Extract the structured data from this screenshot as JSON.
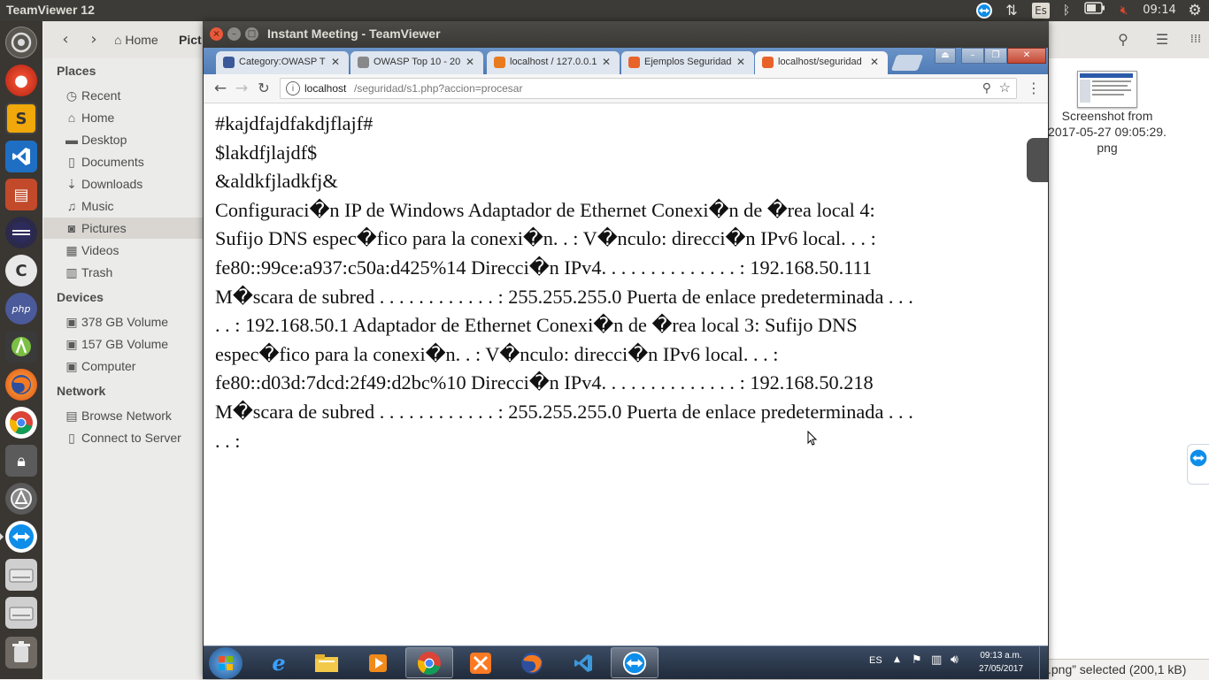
{
  "top_panel": {
    "app_title": "TeamViewer 12",
    "keyboard_layout": "Es",
    "clock": "09:14"
  },
  "nautilus": {
    "nav_home": "Home",
    "nav_current": "Pict",
    "sidebar": {
      "places_header": "Places",
      "places": [
        {
          "label": "Recent",
          "icon": "clock-icon"
        },
        {
          "label": "Home",
          "icon": "home-icon"
        },
        {
          "label": "Desktop",
          "icon": "folder-icon"
        },
        {
          "label": "Documents",
          "icon": "document-icon"
        },
        {
          "label": "Downloads",
          "icon": "download-icon"
        },
        {
          "label": "Music",
          "icon": "music-icon"
        },
        {
          "label": "Pictures",
          "icon": "camera-icon"
        },
        {
          "label": "Videos",
          "icon": "film-icon"
        },
        {
          "label": "Trash",
          "icon": "trash-icon"
        }
      ],
      "devices_header": "Devices",
      "devices": [
        {
          "label": "378 GB Volume",
          "icon": "drive-icon"
        },
        {
          "label": "157 GB Volume",
          "icon": "drive-icon"
        },
        {
          "label": "Computer",
          "icon": "drive-icon"
        }
      ],
      "network_header": "Network",
      "network": [
        {
          "label": "Browse Network",
          "icon": "network-icon"
        },
        {
          "label": "Connect to Server",
          "icon": "server-icon"
        }
      ]
    },
    "file": {
      "name_line1": "Screenshot from",
      "name_line2": "2017-05-27 09:05:29.",
      "name_line3": "png"
    },
    "status": ".png” selected  (200,1 kB)"
  },
  "teamviewer": {
    "title": "Instant Meeting - TeamViewer"
  },
  "browser": {
    "tabs": [
      {
        "title": "Category:OWASP T",
        "color": "#3b5998"
      },
      {
        "title": "OWASP Top 10 - 20",
        "color": "#888888"
      },
      {
        "title": "localhost / 127.0.0.1",
        "color": "#e87b20"
      },
      {
        "title": "Ejemplos Seguridad",
        "color": "#e8632a"
      },
      {
        "title": "localhost/seguridad",
        "color": "#e8632a"
      }
    ],
    "url_host": "localhost",
    "url_path": "/seguridad/s1.php?accion=procesar",
    "page_lines": [
      "#kajdfajdfakdjflajf#",
      "$lakdfjlajdf$",
      "&aldkfjladkfj&",
      "Configuraci�n IP de Windows Adaptador de Ethernet Conexi�n de �rea local 4:",
      "Sufijo DNS espec�fico para la conexi�n. . : V�nculo: direcci�n IPv6 local. . . :",
      "fe80::99ce:a937:c50a:d425%14 Direcci�n IPv4. . . . . . . . . . . . . . : 192.168.50.111",
      "M�scara de subred . . . . . . . . . . . . : 255.255.255.0 Puerta de enlace predeterminada . . .",
      ". . : 192.168.50.1 Adaptador de Ethernet Conexi�n de �rea local 3: Sufijo DNS",
      "espec�fico para la conexi�n. . : V�nculo: direcci�n IPv6 local. . . :",
      "fe80::d03d:7dcd:2f49:d2bc%10 Direcci�n IPv4. . . . . . . . . . . . . . : 192.168.50.218",
      "M�scara de subred . . . . . . . . . . . . : 255.255.255.0 Puerta de enlace predeterminada . . .",
      ". . :"
    ]
  },
  "win7_taskbar": {
    "lang": "ES",
    "time": "09:13 a.m.",
    "date": "27/05/2017"
  }
}
